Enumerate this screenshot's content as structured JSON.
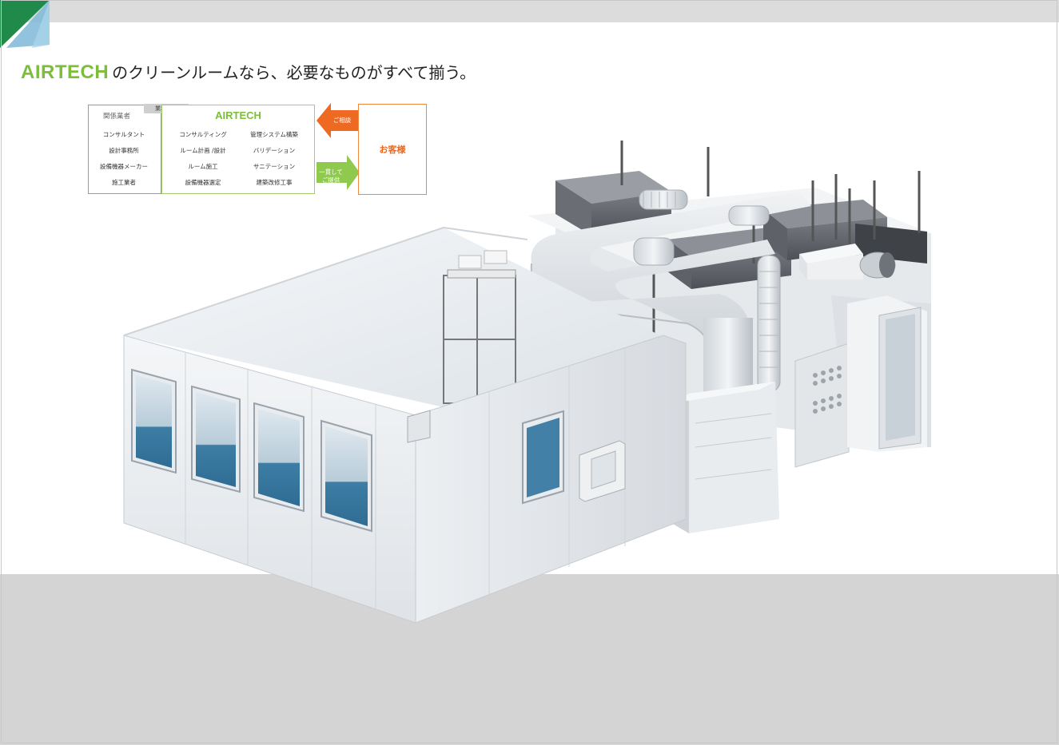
{
  "headline": {
    "brand": "AIRTECH",
    "text": "のクリーンルームなら、必要なものがすべて揃う。"
  },
  "diagram": {
    "vendors": {
      "title": "関係業者",
      "items": [
        "コンサルタント",
        "設計事務所",
        "設備機器メーカー",
        "施工業者"
      ]
    },
    "partnership_tag": "業務提携",
    "airtech": {
      "title": "AIRTECH",
      "left_items": [
        "コンサルティング",
        "ルーム計画 /設計",
        "ルーム施工",
        "設備機器選定"
      ],
      "right_items": [
        "管理システム構築",
        "バリデーション",
        "サニテーション",
        "建築改修工事"
      ]
    },
    "consult_label": "ご相談",
    "provide_label_1": "一貫して",
    "provide_label_2": "ご提供",
    "customer": "お客様"
  },
  "colors": {
    "brand_green": "#7cbd3a",
    "customer_orange": "#e8691e",
    "panel_white": "#eef1f4",
    "glass_blue": "#3d7ea5"
  },
  "icons": [
    "corner-brand-mark",
    "clean-room-illustration"
  ]
}
